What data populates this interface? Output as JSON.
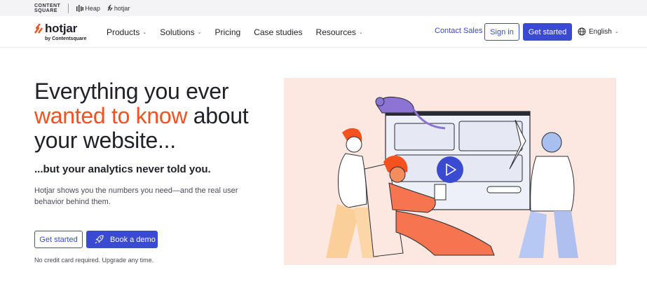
{
  "brandbar": {
    "contentsquare_line1": "CONTENT",
    "contentsquare_line2": "SQUARE",
    "heap": "Heap",
    "hotjar": "hotjar"
  },
  "nav": {
    "logo_word": "hotjar",
    "logo_sub": "by Contentsquare",
    "menu": [
      {
        "label": "Products",
        "dropdown": true
      },
      {
        "label": "Solutions",
        "dropdown": true
      },
      {
        "label": "Pricing",
        "dropdown": false
      },
      {
        "label": "Case studies",
        "dropdown": false
      },
      {
        "label": "Resources",
        "dropdown": true
      }
    ],
    "contact_sales": "Contact Sales",
    "sign_in": "Sign in",
    "get_started": "Get started",
    "language": "English"
  },
  "hero": {
    "headline_part1": "Everything you ever",
    "headline_accent": "wanted to know",
    "headline_part2": " about",
    "headline_part3": "your website...",
    "subhead": "...but your analytics never told you.",
    "description": "Hotjar shows you the numbers you need—and the real user behavior behind them.",
    "primary_button": "Get started",
    "demo_button": "Book a demo",
    "note": "No credit card required. Upgrade any time."
  },
  "colors": {
    "brand_blue": "#3a4ad1",
    "accent_orange": "#f4511e",
    "illustration_bg": "#fde8e1"
  },
  "icons": {
    "logo": "hotjar-flame-icon",
    "language": "globe-icon",
    "demo": "rocket-icon",
    "video": "play-icon"
  }
}
